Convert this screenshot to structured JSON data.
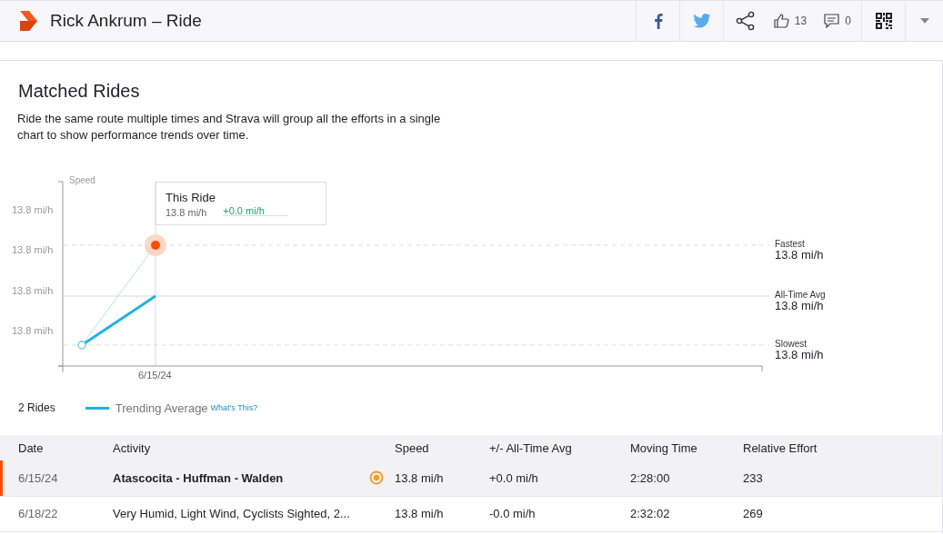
{
  "header": {
    "title": "Rick Ankrum – Ride",
    "kudos": "13",
    "comments": "0"
  },
  "section": {
    "title": "Matched Rides",
    "description": "Ride the same route multiple times and Strava will group all the efforts in a single chart to show performance trends over time."
  },
  "chart": {
    "y_label": "Speed",
    "y_ticks": [
      "13.8 mi/h",
      "13.8 mi/h",
      "13.8 mi/h",
      "13.8 mi/h"
    ],
    "x_tick": "6/15/24",
    "tooltip": {
      "title": "This Ride",
      "speed": "13.8 mi/h",
      "diff": "+0.0 mi/h"
    },
    "references": [
      {
        "label": "Fastest",
        "value": "13.8 mi/h",
        "kind": "dashed"
      },
      {
        "label": "All-Time Avg",
        "value": "13.8 mi/h",
        "kind": "solid"
      },
      {
        "label": "Slowest",
        "value": "13.8 mi/h",
        "kind": "dashed"
      }
    ]
  },
  "legend": {
    "count": "2 Rides",
    "trend": "Trending Average",
    "link": "What's This?"
  },
  "table": {
    "columns": [
      "Date",
      "Activity",
      "Speed",
      "+/- All-Time Avg",
      "Moving Time",
      "Relative Effort"
    ],
    "rows": [
      {
        "selected": true,
        "target_icon": true,
        "cells": [
          "6/15/24",
          "Atascocita - Huffman - Walden",
          "13.8 mi/h",
          "+0.0 mi/h",
          "2:28:00",
          "233"
        ]
      },
      {
        "selected": false,
        "target_icon": false,
        "cells": [
          "6/18/22",
          "Very Humid, Light Wind, Cyclists Sighted, 2...",
          "13.8 mi/h",
          "-0.0 mi/h",
          "2:32:02",
          "269"
        ]
      }
    ]
  }
}
